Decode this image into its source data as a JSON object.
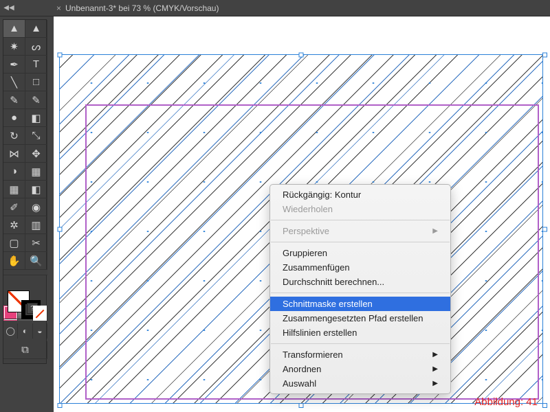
{
  "tab": {
    "close_glyph": "×",
    "title": "Unbenannt-3* bei 73 % (CMYK/Vorschau)"
  },
  "collapse_glyph": "◀◀",
  "tools": [
    {
      "name": "selection-tool",
      "glyph": "▲",
      "selected": true
    },
    {
      "name": "direct-selection-tool",
      "glyph": "▲"
    },
    {
      "name": "magic-wand-tool",
      "glyph": "✷"
    },
    {
      "name": "lasso-tool",
      "glyph": "ᔕ"
    },
    {
      "name": "pen-tool",
      "glyph": "✒"
    },
    {
      "name": "type-tool",
      "glyph": "T"
    },
    {
      "name": "line-tool",
      "glyph": "╲"
    },
    {
      "name": "rectangle-tool",
      "glyph": "□"
    },
    {
      "name": "paintbrush-tool",
      "glyph": "✎"
    },
    {
      "name": "pencil-tool",
      "glyph": "✎"
    },
    {
      "name": "blob-brush-tool",
      "glyph": "●"
    },
    {
      "name": "eraser-tool",
      "glyph": "◧"
    },
    {
      "name": "rotate-tool",
      "glyph": "↻"
    },
    {
      "name": "scale-tool",
      "glyph": "⤡"
    },
    {
      "name": "width-tool",
      "glyph": "⋈"
    },
    {
      "name": "free-transform-tool",
      "glyph": "✥"
    },
    {
      "name": "shape-builder-tool",
      "glyph": "◑"
    },
    {
      "name": "perspective-grid-tool",
      "glyph": "▦"
    },
    {
      "name": "mesh-tool",
      "glyph": "▦"
    },
    {
      "name": "gradient-tool",
      "glyph": "◧"
    },
    {
      "name": "eyedropper-tool",
      "glyph": "✐"
    },
    {
      "name": "blend-tool",
      "glyph": "◉"
    },
    {
      "name": "symbol-sprayer-tool",
      "glyph": "✲"
    },
    {
      "name": "column-graph-tool",
      "glyph": "▥"
    },
    {
      "name": "artboard-tool",
      "glyph": "▢"
    },
    {
      "name": "slice-tool",
      "glyph": "✂"
    },
    {
      "name": "hand-tool",
      "glyph": "✋"
    },
    {
      "name": "zoom-tool",
      "glyph": "🔍"
    }
  ],
  "mode_row": [
    {
      "name": "draw-normal",
      "glyph": "◯"
    },
    {
      "name": "draw-behind",
      "glyph": "◐"
    },
    {
      "name": "draw-inside",
      "glyph": "◒"
    }
  ],
  "screen_row": [
    {
      "name": "screen-mode",
      "glyph": "⧉"
    }
  ],
  "context_menu": {
    "items": [
      {
        "label": "Rückgängig: Kontur",
        "state": "normal"
      },
      {
        "label": "Wiederholen",
        "state": "disabled"
      },
      {
        "sep": true
      },
      {
        "label": "Perspektive",
        "state": "disabled",
        "submenu": true
      },
      {
        "sep": true
      },
      {
        "label": "Gruppieren",
        "state": "normal"
      },
      {
        "label": "Zusammenfügen",
        "state": "normal"
      },
      {
        "label": "Durchschnitt berechnen...",
        "state": "normal"
      },
      {
        "sep": true
      },
      {
        "label": "Schnittmaske erstellen",
        "state": "highlight"
      },
      {
        "label": "Zusammengesetzten Pfad erstellen",
        "state": "normal"
      },
      {
        "label": "Hilfslinien erstellen",
        "state": "normal"
      },
      {
        "sep": true
      },
      {
        "label": "Transformieren",
        "state": "normal",
        "submenu": true
      },
      {
        "label": "Anordnen",
        "state": "normal",
        "submenu": true
      },
      {
        "label": "Auswahl",
        "state": "normal",
        "submenu": true
      }
    ]
  },
  "caption": "Abbildung: 41",
  "colors": {
    "guide": "#2a80d8",
    "artboard": "#b060c8",
    "menu_highlight": "#2f6fe0"
  }
}
